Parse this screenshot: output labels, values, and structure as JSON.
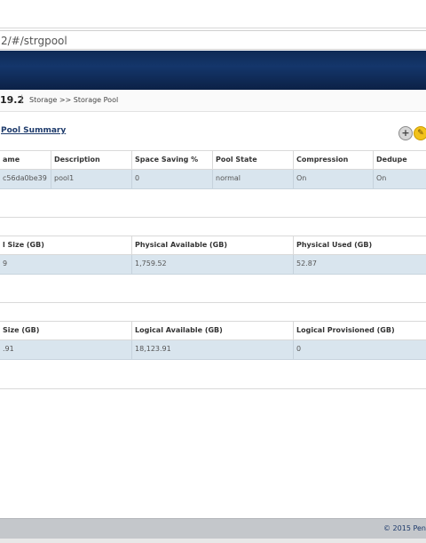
{
  "browser": {
    "address": "2/#/strgpool"
  },
  "breadcrumb": {
    "version": "19.2",
    "separator": "|",
    "path": "Storage >> Storage Pool"
  },
  "pool_summary": {
    "title": "Pool Summary",
    "add_icon": "plus-icon",
    "edit_icon": "pencil-icon"
  },
  "pool_table": {
    "headers": [
      "ame",
      "Description",
      "Space Saving %",
      "Pool State",
      "Compression",
      "Dedupe"
    ],
    "row": [
      "c56da0be39",
      "pool1",
      "0",
      "normal",
      "On",
      "On"
    ]
  },
  "physical_table": {
    "headers": [
      "l Size (GB)",
      "Physical Available (GB)",
      "Physical Used (GB)"
    ],
    "row": [
      "9",
      "1,759.52",
      "52.87"
    ]
  },
  "logical_table": {
    "headers": [
      "Size (GB)",
      "Logical Available (GB)",
      "Logical Provisioned (GB)"
    ],
    "row": [
      ".91",
      "18,123.91",
      "0"
    ]
  },
  "footer": {
    "copyright": "© 2015 Pen"
  }
}
